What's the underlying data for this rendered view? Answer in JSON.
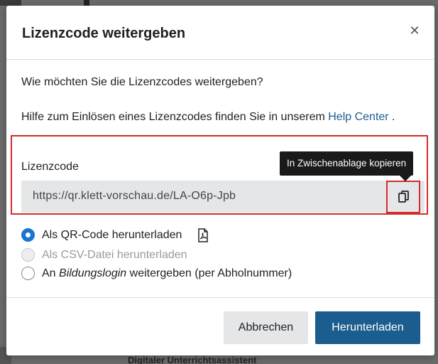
{
  "background": {
    "strip_text": "Digitaler Unterrichtsassistent"
  },
  "modal": {
    "title": "Lizenzcode weitergeben",
    "close_icon": "close-icon",
    "question": "Wie möchten Sie die Lizenzcodes weitergeben?",
    "help_prefix": "Hilfe zum Einlösen eines Lizenzcodes finden Sie in unserem ",
    "help_link": "Help Center",
    "help_suffix": " .",
    "field_label": "Lizenzcode",
    "code_value": "https://qr.klett-vorschau.de/LA-O6p-Jpb",
    "copy_tooltip": "In Zwischenablage kopieren",
    "copy_icon": "copy-icon",
    "options": [
      {
        "label": "Als QR-Code herunterladen",
        "checked": true,
        "disabled": false,
        "icon": "pdf-icon"
      },
      {
        "label": "Als CSV-Datei herunterladen",
        "checked": false,
        "disabled": true
      },
      {
        "label_prefix": "An ",
        "label_emphasis": "Bildungslogin",
        "label_suffix": " weitergeben (per Abholnummer)",
        "checked": false,
        "disabled": false
      }
    ],
    "cancel_label": "Abbrechen",
    "submit_label": "Herunterladen"
  },
  "colors": {
    "primary": "#1c5d8f",
    "radio_checked": "#1c74d1",
    "highlight": "#d42b2b",
    "field_bg": "#e4e6e8",
    "tooltip_bg": "#1a1a1a"
  }
}
